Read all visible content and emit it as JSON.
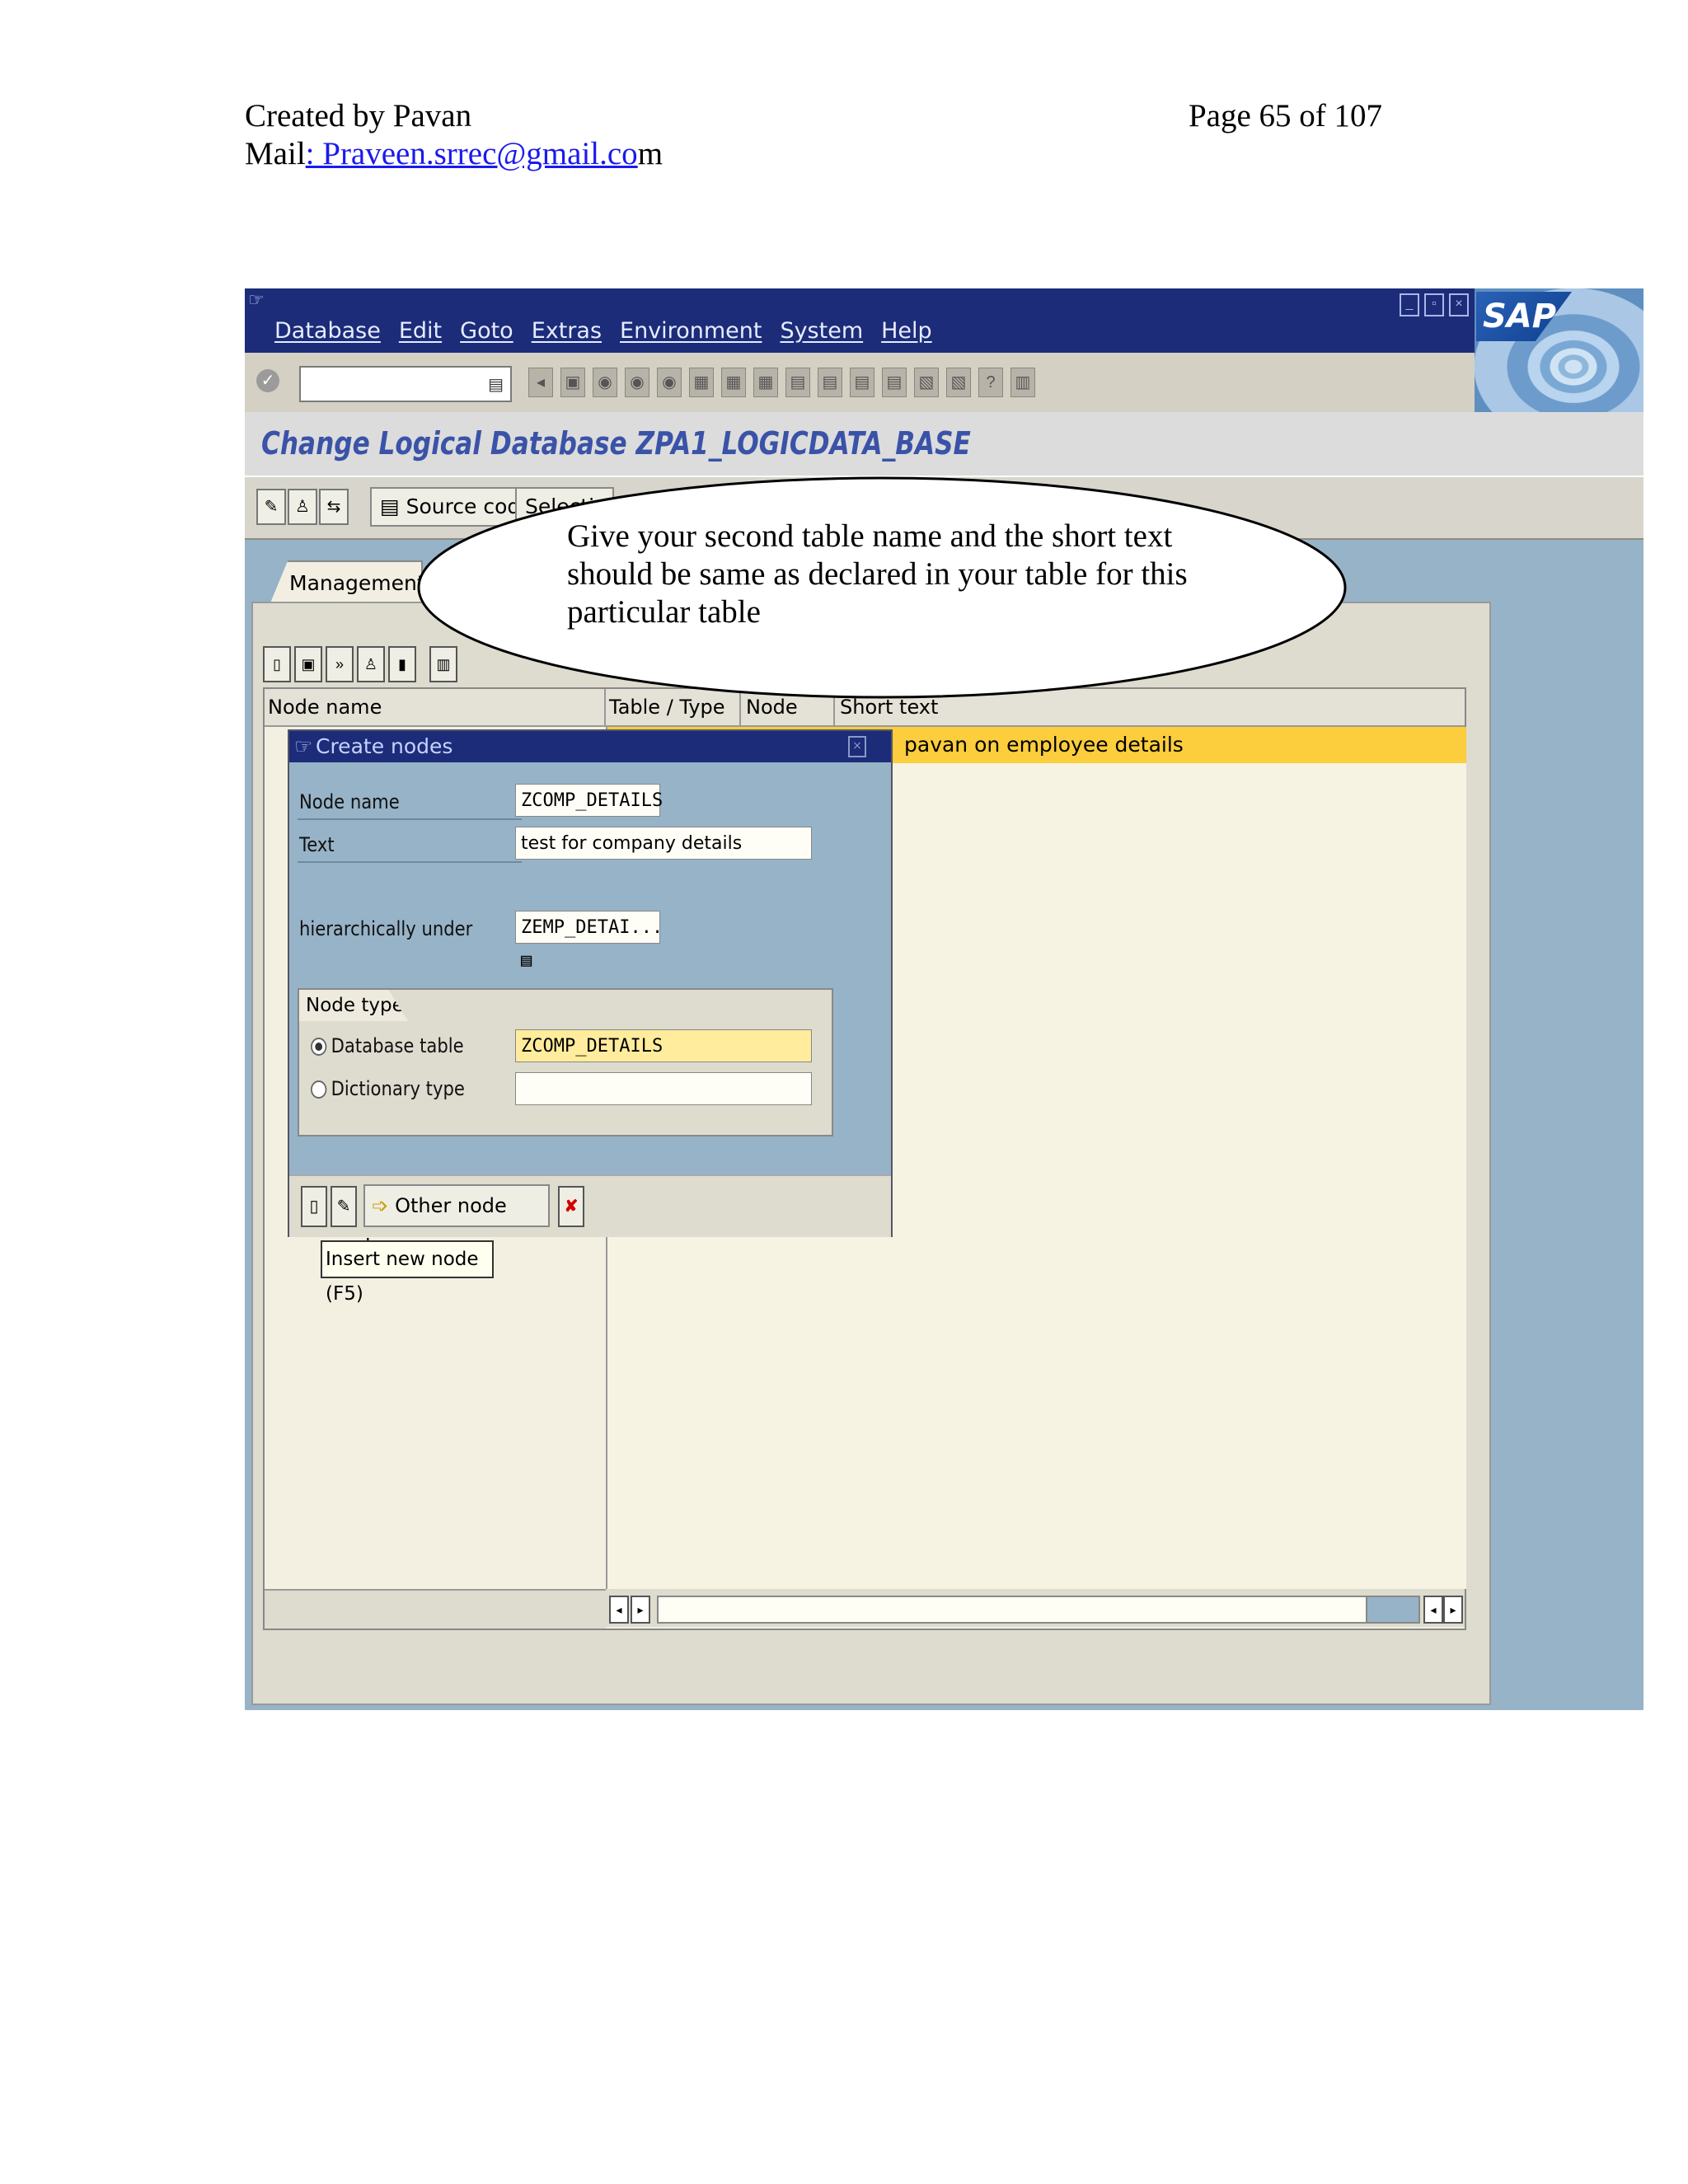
{
  "doc": {
    "created_by": "Created by  Pavan",
    "mail_prefix": "Mail",
    "mail_link": ": Praveen.srrec@gmail.co",
    "mail_suffix": "m",
    "page": "Page 65 of 107"
  },
  "sap": {
    "menu": [
      "Database",
      "Edit",
      "Goto",
      "Extras",
      "Environment",
      "System",
      "Help"
    ],
    "logo": "SAP",
    "screen_title": "Change Logical Database ZPA1_LOGICDATA_BASE",
    "toolbar2": {
      "source_code": "Source code",
      "selections": "Selection"
    },
    "tab_management": "Management",
    "tree_columns": {
      "node_name": "Node name",
      "table_type": "Table / Type",
      "node_type": "Node type",
      "short_text": "Short text"
    },
    "highlight_row_text": "pavan on employee details"
  },
  "dialog": {
    "title": "Create nodes",
    "node_name_label": "Node name",
    "node_name_value": "ZCOMP_DETAILS",
    "text_label": "Text",
    "text_value": "test for company details",
    "hier_label": "hierarchically under",
    "hier_value": "ZEMP_DETAI...",
    "node_type_group": "Node type",
    "db_table_label": "Database table",
    "db_table_value": "ZCOMP_DETAILS",
    "dict_type_label": "Dictionary type",
    "dict_type_value": "",
    "other_node_types": "Other node types"
  },
  "tooltip": "Insert new node   (F5)",
  "callout": "Give your second table name and the short text should be same as declared in your table for this particular table",
  "colors": {
    "sap_blue": "#1c2c79",
    "background": "#97b3c7",
    "highlight": "#fccd3c"
  }
}
